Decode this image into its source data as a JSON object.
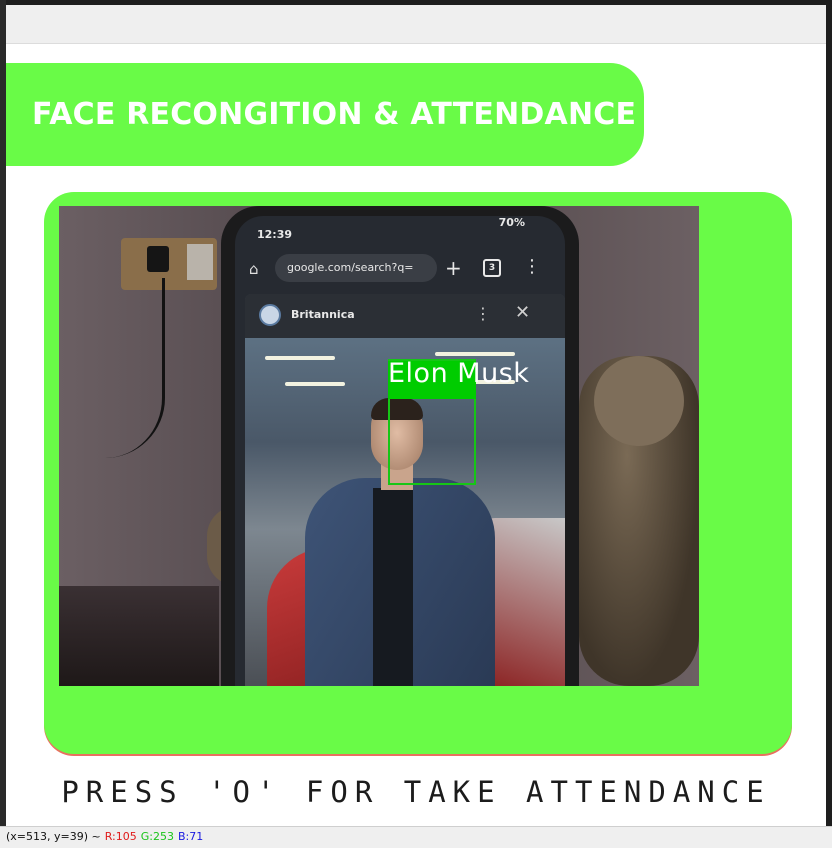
{
  "window": {
    "title": "FACE RECONGITION & ATTENDANCE"
  },
  "camera": {
    "detected_name": "Elon Musk",
    "phone": {
      "status_time": "12:39",
      "status_right": "70%",
      "url": "google.com/search?q=",
      "tabs_count": "3",
      "sheet_source": "Britannica"
    }
  },
  "instruction": "PRESS 'O' FOR TAKE ATTENDANCE",
  "statusbar": {
    "coords": "(x=513, y=39) ~",
    "r": "R:105",
    "g": "G:253",
    "b": "B:71"
  },
  "colors": {
    "accent_green": "#69fb47",
    "frame_shadow": "#e8705f",
    "detection_box": "#00cc00"
  }
}
